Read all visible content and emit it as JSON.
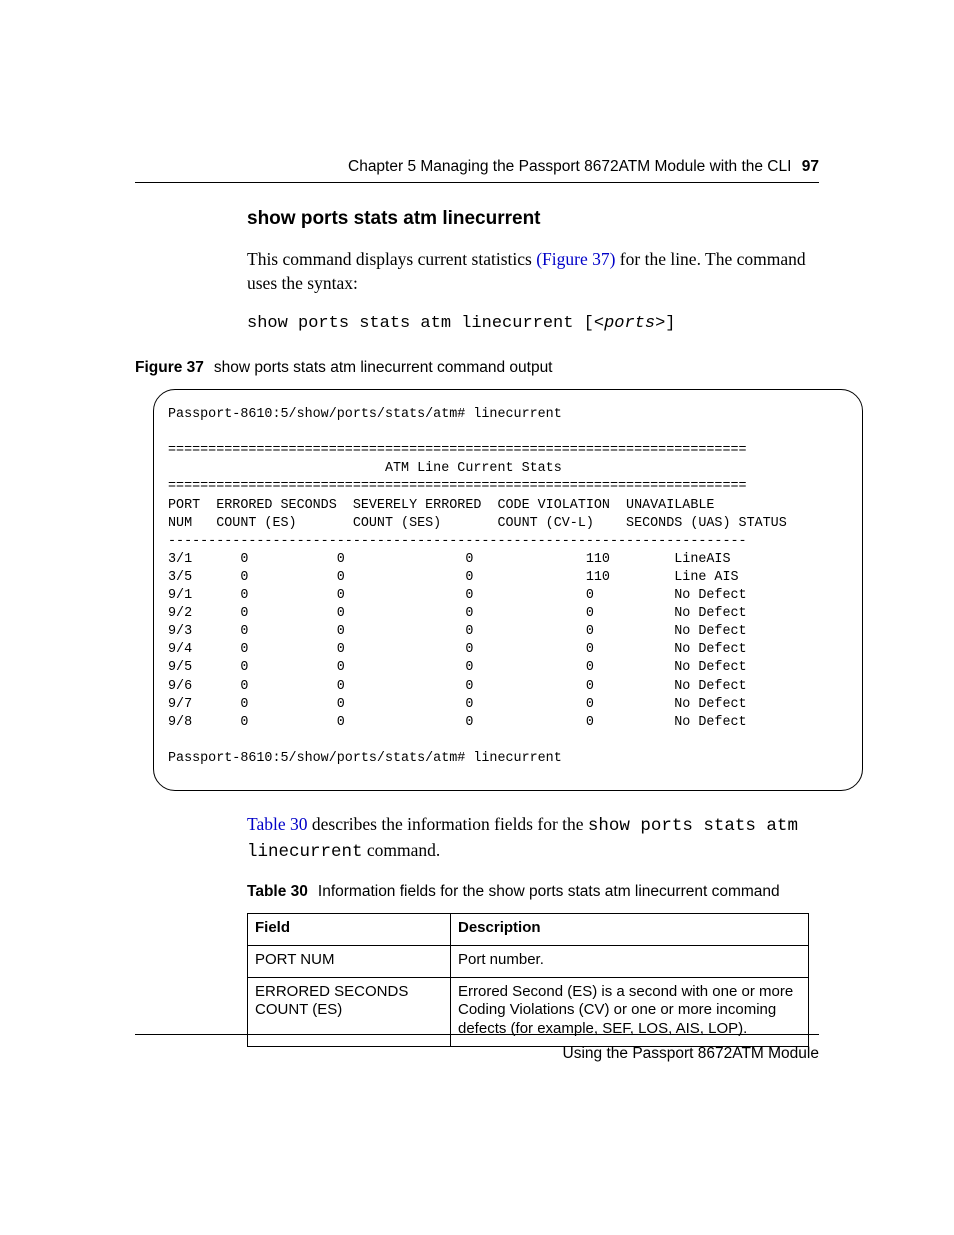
{
  "header": {
    "running": "Chapter 5  Managing the Passport 8672ATM Module with the CLI",
    "page_number": "97"
  },
  "section": {
    "title": "show ports stats atm linecurrent",
    "intro_a": "This command displays current statistics ",
    "intro_link": "(Figure 37)",
    "intro_b": " for the line. The command uses the syntax:",
    "syntax_prefix": "show ports stats atm linecurrent [<",
    "syntax_param": "ports",
    "syntax_suffix": ">]"
  },
  "figure": {
    "label": "Figure 37",
    "caption": "show ports stats atm linecurrent command output",
    "prompt1": "Passport-8610:5/show/ports/stats/atm# linecurrent",
    "bar": "========================================================================",
    "title": "                           ATM Line Current Stats",
    "hdr1": "PORT  ERRORED SECONDS  SEVERELY ERRORED  CODE VIOLATION  UNAVAILABLE",
    "hdr2": "NUM   COUNT (ES)       COUNT (SES)       COUNT (CV-L)    SECONDS (UAS) STATUS",
    "dash": "------------------------------------------------------------------------",
    "rows": [
      "3/1      0           0               0              110        LineAIS",
      "3/5      0           0               0              110        Line AIS",
      "9/1      0           0               0              0          No Defect",
      "9/2      0           0               0              0          No Defect",
      "9/3      0           0               0              0          No Defect",
      "9/4      0           0               0              0          No Defect",
      "9/5      0           0               0              0          No Defect",
      "9/6      0           0               0              0          No Defect",
      "9/7      0           0               0              0          No Defect",
      "9/8      0           0               0              0          No Defect"
    ],
    "prompt2": "Passport-8610:5/show/ports/stats/atm# linecurrent"
  },
  "post_fig": {
    "a": " describes the information fields for the ",
    "link": "Table 30",
    "cmd": "show ports stats atm linecurrent",
    "b": " command."
  },
  "table": {
    "label": "Table 30",
    "caption": "Information fields for the show ports stats atm linecurrent command",
    "head_field": "Field",
    "head_desc": "Description",
    "rows": [
      {
        "field": "PORT NUM",
        "desc": "Port number."
      },
      {
        "field": "ERRORED SECONDS COUNT (ES)",
        "desc": "Errored Second (ES) is a second with one or more Coding Violations (CV) or one or more incoming defects (for example, SEF, LOS, AIS, LOP)."
      }
    ]
  },
  "footer": "Using the Passport 8672ATM Module",
  "chart_data": {
    "type": "table",
    "title": "ATM Line Current Stats",
    "columns": [
      "PORT NUM",
      "ERRORED SECONDS COUNT (ES)",
      "SEVERELY ERRORED COUNT (SES)",
      "CODE VIOLATION COUNT (CV-L)",
      "UNAVAILABLE SECONDS (UAS)",
      "STATUS"
    ],
    "rows": [
      [
        "3/1",
        0,
        0,
        0,
        110,
        "LineAIS"
      ],
      [
        "3/5",
        0,
        0,
        0,
        110,
        "Line AIS"
      ],
      [
        "9/1",
        0,
        0,
        0,
        0,
        "No Defect"
      ],
      [
        "9/2",
        0,
        0,
        0,
        0,
        "No Defect"
      ],
      [
        "9/3",
        0,
        0,
        0,
        0,
        "No Defect"
      ],
      [
        "9/4",
        0,
        0,
        0,
        0,
        "No Defect"
      ],
      [
        "9/5",
        0,
        0,
        0,
        0,
        "No Defect"
      ],
      [
        "9/6",
        0,
        0,
        0,
        0,
        "No Defect"
      ],
      [
        "9/7",
        0,
        0,
        0,
        0,
        "No Defect"
      ],
      [
        "9/8",
        0,
        0,
        0,
        0,
        "No Defect"
      ]
    ]
  }
}
